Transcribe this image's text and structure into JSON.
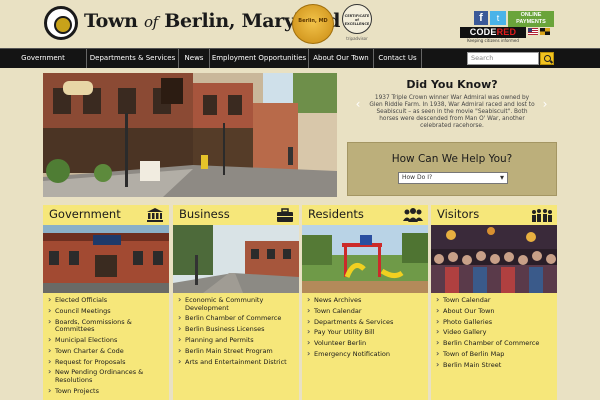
{
  "header": {
    "title_part1": "Town",
    "title_of": "of",
    "title_part2": "Berlin, Maryland",
    "award_gold_text": "Berlin, MD",
    "award_ta_text": "CERTIFICATE of EXCELLENCE",
    "award_ta_caption": "tripadvisor",
    "social": {
      "facebook": "f",
      "twitter": "t"
    },
    "pay_button": "ONLINE PAYMENTS",
    "codered": {
      "code": "CODE",
      "red": "RED"
    },
    "codered_tagline": "Keeping citizens informed",
    "icons": [
      "seal-icon",
      "facebook-icon",
      "twitter-icon",
      "flag-icon"
    ]
  },
  "nav": {
    "items": [
      "Government",
      "Departments & Services",
      "News",
      "Employment Opportunities",
      "About Our Town",
      "Contact Us"
    ],
    "search_placeholder": "Search"
  },
  "did_you_know": {
    "title": "Did You Know?",
    "text": "1937 Triple Crown winner War Admiral was owned by Glen Riddle Farm. In 1938, War Admiral raced and lost to Seabiscuit – as seen in the movie \"Seabiscuit\". Both horses were descended from Man O' War, another celebrated racehorse.",
    "prev": "‹",
    "next": "›"
  },
  "help": {
    "title": "How Can We Help You?",
    "select_value": "How Do I?"
  },
  "cards": [
    {
      "title": "Government",
      "icon": "columns-icon",
      "items": [
        "Elected Officials",
        "Council Meetings",
        "Boards, Commissions & Committees",
        "Municipal Elections",
        "Town Charter & Code",
        "Request for Proposals",
        "New Pending Ordinances & Resolutions",
        "Town Projects"
      ]
    },
    {
      "title": "Business",
      "icon": "briefcase-icon",
      "items": [
        "Economic & Community Development",
        "Berlin Chamber of Commerce",
        "Berlin Business Licenses",
        "Planning and Permits",
        "Berlin Main Street Program",
        "Arts and Entertainment District"
      ]
    },
    {
      "title": "Residents",
      "icon": "people-icon",
      "items": [
        "News Archives",
        "Town Calendar",
        "Departments & Services",
        "Pay Your Utility Bill",
        "Volunteer Berlin",
        "Emergency Notification"
      ]
    },
    {
      "title": "Visitors",
      "icon": "crowd-icon",
      "items": [
        "Town Calendar",
        "About Our Town",
        "Photo Galleries",
        "Video Gallery",
        "Berlin Chamber of Commerce",
        "Town of Berlin Map",
        "Berlin Main Street"
      ]
    }
  ],
  "colors": {
    "page_bg": "#e9e1c3",
    "nav_bg": "#141414",
    "card_yellow": "#f6e77a",
    "help_box": "#bcaf7b",
    "search_button": "#f2c31f"
  }
}
